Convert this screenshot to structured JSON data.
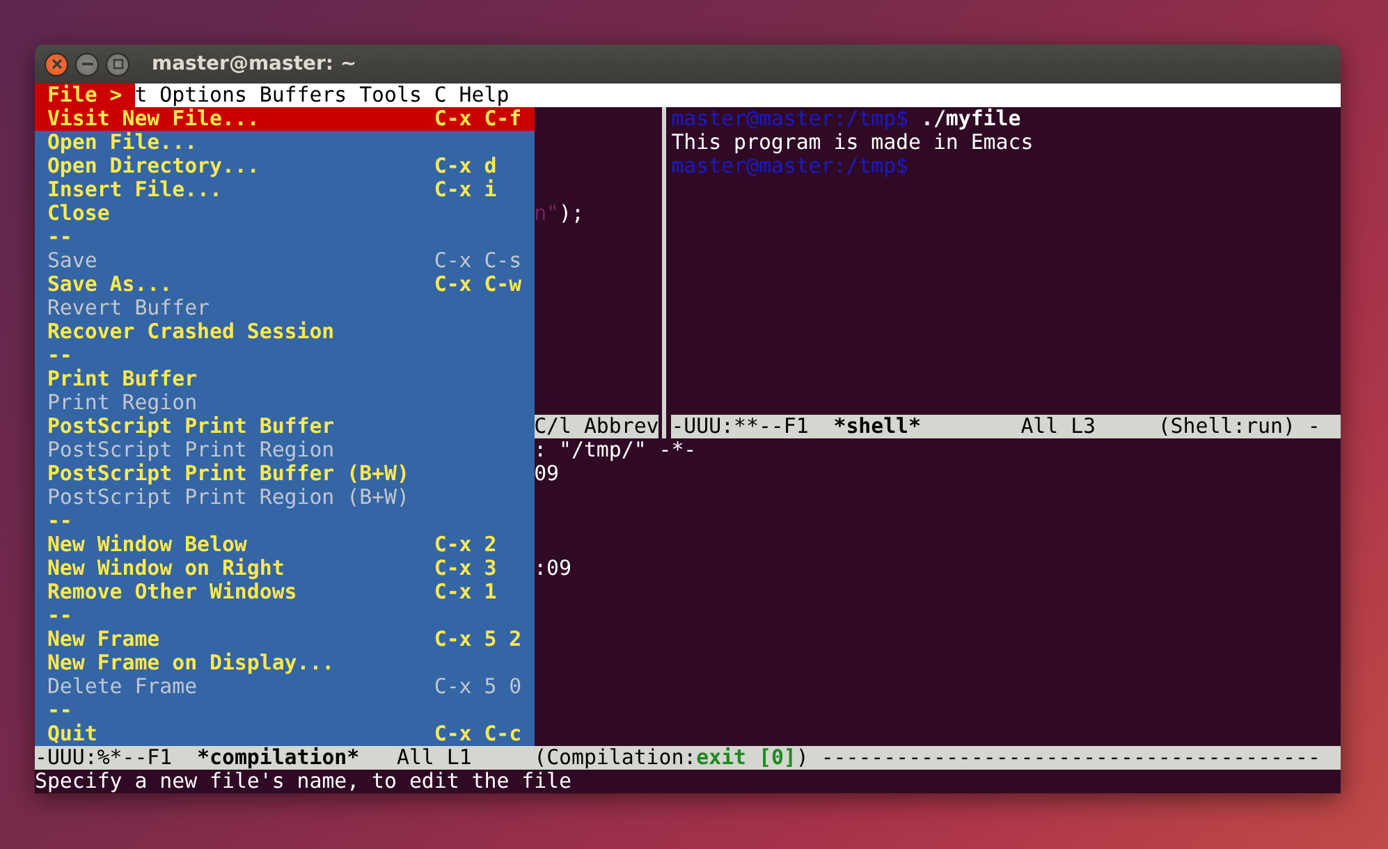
{
  "window": {
    "title": "master@master: ~"
  },
  "menu_bar": {
    "text": "t Options Buffers Tools C Help"
  },
  "file_menu": {
    "title": "File >",
    "items": [
      {
        "kind": "item",
        "label": "Visit New File...",
        "shortcut": "C-x C-f",
        "selected": true,
        "disabled": false
      },
      {
        "kind": "item",
        "label": "Open File...",
        "selected": false,
        "disabled": false
      },
      {
        "kind": "item",
        "label": "Open Directory...",
        "shortcut": "C-x d",
        "selected": false,
        "disabled": false
      },
      {
        "kind": "item",
        "label": "Insert File...",
        "shortcut": "C-x i",
        "selected": false,
        "disabled": false
      },
      {
        "kind": "item",
        "label": "Close",
        "selected": false,
        "disabled": false
      },
      {
        "kind": "separator",
        "label": "--",
        "selected": false,
        "disabled": false
      },
      {
        "kind": "item",
        "label": "Save",
        "shortcut": "C-x C-s",
        "selected": false,
        "disabled": true
      },
      {
        "kind": "item",
        "label": "Save As...",
        "shortcut": "C-x C-w",
        "selected": false,
        "disabled": false
      },
      {
        "kind": "item",
        "label": "Revert Buffer",
        "selected": false,
        "disabled": true
      },
      {
        "kind": "item",
        "label": "Recover Crashed Session",
        "selected": false,
        "disabled": false
      },
      {
        "kind": "separator",
        "label": "--",
        "selected": false,
        "disabled": false
      },
      {
        "kind": "item",
        "label": "Print Buffer",
        "selected": false,
        "disabled": false
      },
      {
        "kind": "item",
        "label": "Print Region",
        "selected": false,
        "disabled": true
      },
      {
        "kind": "item",
        "label": "PostScript Print Buffer",
        "selected": false,
        "disabled": false
      },
      {
        "kind": "item",
        "label": "PostScript Print Region",
        "selected": false,
        "disabled": true
      },
      {
        "kind": "item",
        "label": "PostScript Print Buffer (B+W)",
        "selected": false,
        "disabled": false
      },
      {
        "kind": "item",
        "label": "PostScript Print Region (B+W)",
        "selected": false,
        "disabled": true
      },
      {
        "kind": "separator",
        "label": "--",
        "selected": false,
        "disabled": false
      },
      {
        "kind": "item",
        "label": "New Window Below",
        "shortcut": "C-x 2",
        "selected": false,
        "disabled": false
      },
      {
        "kind": "item",
        "label": "New Window on Right",
        "shortcut": "C-x 3",
        "selected": false,
        "disabled": false
      },
      {
        "kind": "item",
        "label": "Remove Other Windows",
        "shortcut": "C-x 1",
        "selected": false,
        "disabled": false
      },
      {
        "kind": "separator",
        "label": "--",
        "selected": false,
        "disabled": false
      },
      {
        "kind": "item",
        "label": "New Frame",
        "shortcut": "C-x 5 2",
        "selected": false,
        "disabled": false
      },
      {
        "kind": "item",
        "label": "New Frame on Display...",
        "selected": false,
        "disabled": false
      },
      {
        "kind": "item",
        "label": "Delete Frame",
        "shortcut": "C-x 5 0",
        "selected": false,
        "disabled": true
      },
      {
        "kind": "separator",
        "label": "--",
        "selected": false,
        "disabled": false
      },
      {
        "kind": "item",
        "label": "Quit",
        "shortcut": "C-x C-c",
        "selected": false,
        "disabled": false
      }
    ]
  },
  "code_window": {
    "lines": [
      {
        "segments": [
          {
            "kind": "string",
            "text": "n\""
          },
          {
            "kind": "plain",
            "text": ");"
          }
        ]
      }
    ],
    "mode_line": "C/l Abbrev"
  },
  "shell_window": {
    "lines": [
      {
        "kind": "prompt",
        "text": "master@master:/tmp$",
        "command": "./myfile"
      },
      {
        "kind": "output",
        "text": "This program is made in Emacs"
      },
      {
        "kind": "prompt",
        "text": "master@master:/tmp$"
      }
    ],
    "mode_line": [
      {
        "kind": "plain",
        "text": "-UUU:**--F1  "
      },
      {
        "kind": "buffer",
        "text": "*shell*"
      },
      {
        "kind": "plain",
        "text": "        All L3     (Shell:run) -"
      }
    ]
  },
  "compilation_window": {
    "lines": [
      ": \"/tmp/\" -*-",
      "09",
      ":09"
    ],
    "mode_line": [
      {
        "kind": "plain",
        "text": "-UUU:%*--F1  "
      },
      {
        "kind": "buffer",
        "text": "*compilation*"
      },
      {
        "kind": "plain",
        "text": "   All L1     (Compilation:"
      },
      {
        "kind": "status",
        "text": "exit [0]"
      },
      {
        "kind": "plain",
        "text": ") ----------------------------------------"
      }
    ]
  },
  "echo_area": "Specify a new file's name, to edit the file"
}
